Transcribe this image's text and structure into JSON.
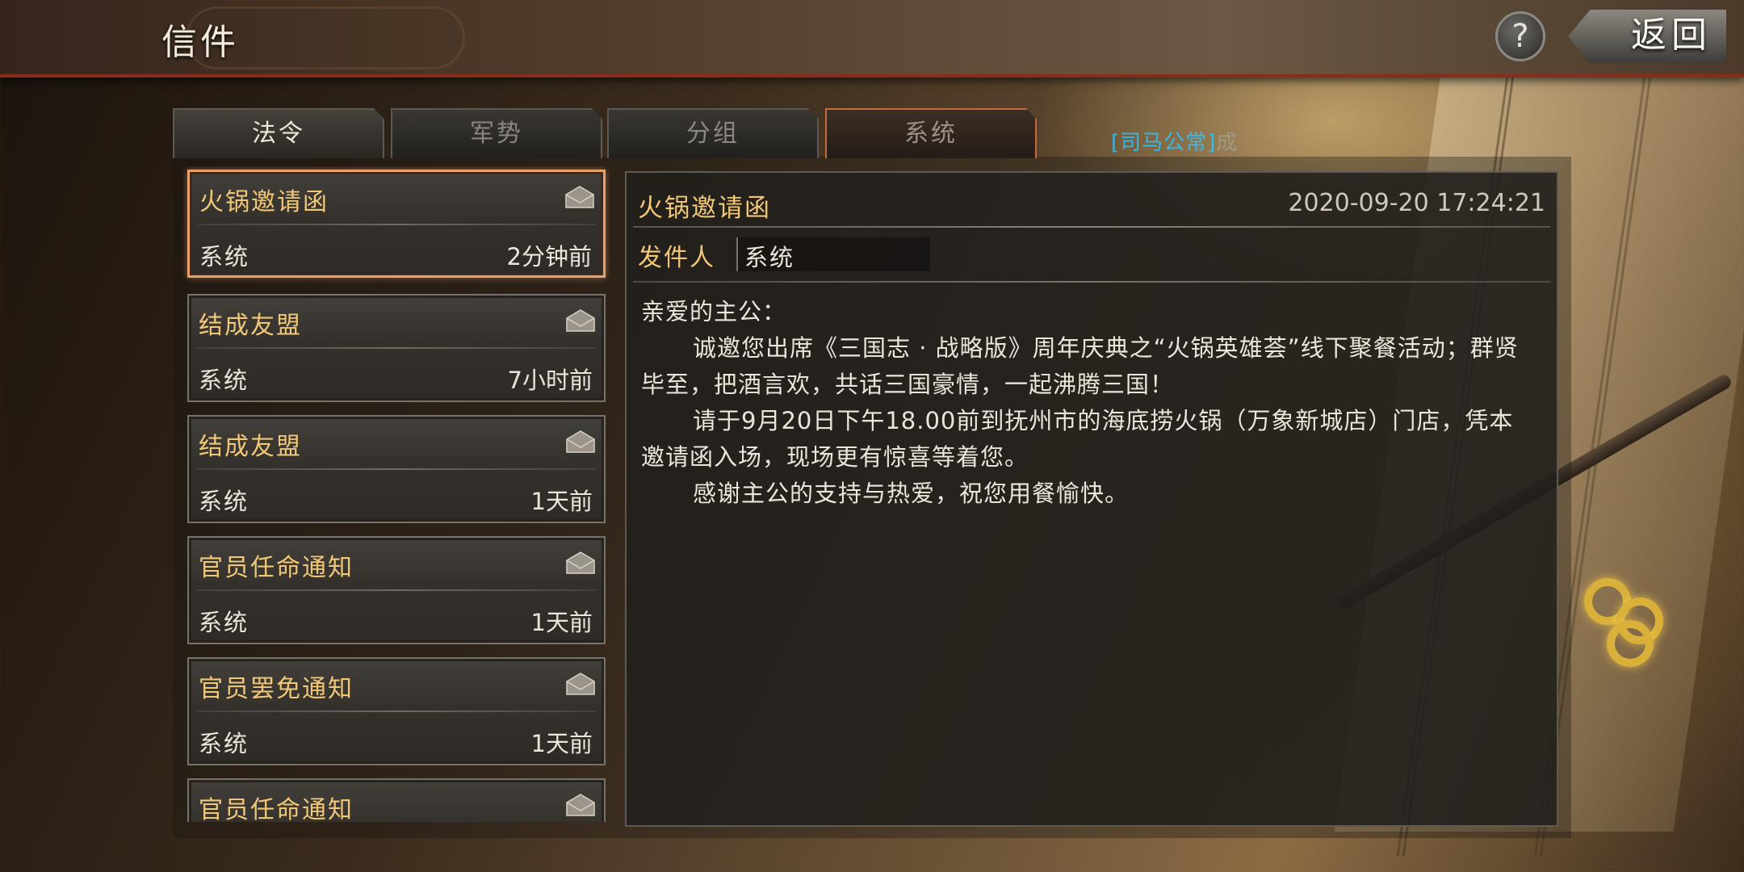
{
  "header": {
    "title": "信件",
    "help_label": "?",
    "back_label": "返回"
  },
  "tabs": [
    {
      "label": "法令",
      "state": "active"
    },
    {
      "label": "军势",
      "state": "inactive"
    },
    {
      "label": "分组",
      "state": "inactive"
    },
    {
      "label": "系统",
      "state": "highlighted"
    }
  ],
  "ticker": {
    "name": "[司马公常]",
    "text": "成"
  },
  "mail_list": [
    {
      "title": "火锅邀请函",
      "sender": "系统",
      "time": "2分钟前",
      "selected": true
    },
    {
      "title": "结成友盟",
      "sender": "系统",
      "time": "7小时前"
    },
    {
      "title": "结成友盟",
      "sender": "系统",
      "time": "1天前"
    },
    {
      "title": "官员任命通知",
      "sender": "系统",
      "time": "1天前"
    },
    {
      "title": "官员罢免通知",
      "sender": "系统",
      "time": "1天前"
    },
    {
      "title": "官员任命通知",
      "sender": "",
      "time": ""
    }
  ],
  "detail": {
    "title": "火锅邀请函",
    "date": "2020-09-20 17:24:21",
    "sender_label": "发件人",
    "sender_value": "系统",
    "body": [
      "亲爱的主公：",
      "诚邀您出席《三国志 · 战略版》周年庆典之“火锅英雄荟”线下聚餐活动；群贤毕至，把酒言欢，共话三国豪情，一起沸腾三国！",
      "请于9月20日下午18.00前到抚州市的海底捞火锅（万象新城店）门店，凭本邀请函入场，现场更有惊喜等着您。",
      "感谢主公的支持与热爱，祝您用餐愉快。"
    ]
  },
  "colors": {
    "title_gold": "#f1c878",
    "text_light": "#ece6da",
    "selected_border": "#e9a16c",
    "ticker_name": "#35b9e6",
    "header_underline": "#8a2b1c"
  },
  "icons": {
    "mail": "envelope-icon",
    "help": "question-icon"
  }
}
